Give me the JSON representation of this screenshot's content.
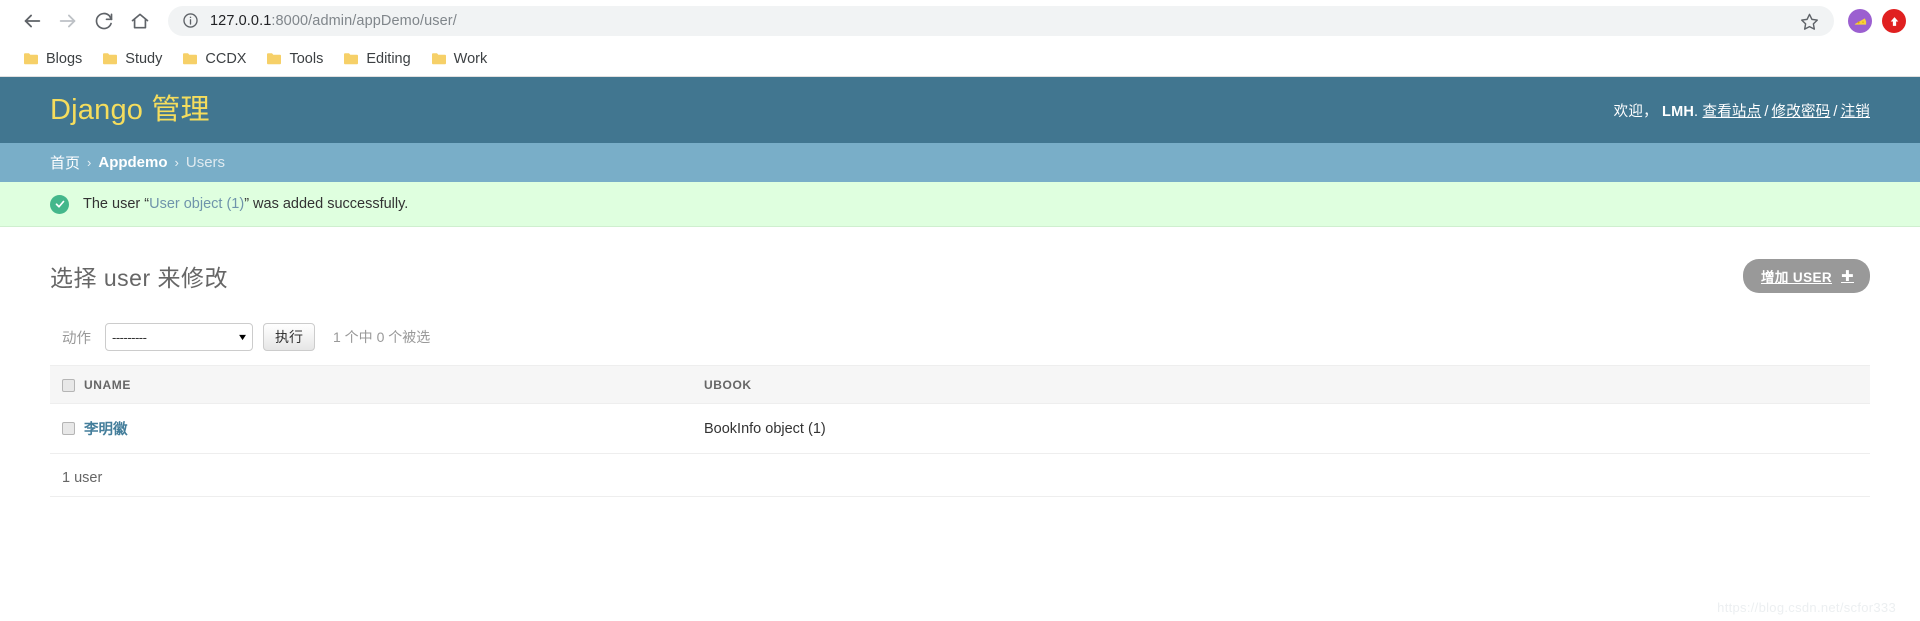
{
  "browser": {
    "nav": {
      "back": "back-arrow",
      "forward": "forward-arrow",
      "reload": "reload",
      "home": "home"
    },
    "url": {
      "host": "127.0.0.1",
      "rest": ":8000/admin/appDemo/user/",
      "full": "127.0.0.1:8000/admin/appDemo/user/"
    },
    "bookmarks": [
      {
        "label": "Blogs"
      },
      {
        "label": "Study"
      },
      {
        "label": "CCDX"
      },
      {
        "label": "Tools"
      },
      {
        "label": "Editing"
      },
      {
        "label": "Work"
      }
    ],
    "extensions": [
      {
        "name": "cheese-extension-icon",
        "color": "#9b5fd0"
      },
      {
        "name": "red-arrow-extension-icon",
        "color": "#e02020"
      }
    ]
  },
  "admin": {
    "brand": "Django 管理",
    "user_tools": {
      "welcome": "欢迎，",
      "username": "LMH",
      "dot": ".",
      "view_site": "查看站点",
      "change_password": "修改密码",
      "logout": "注销",
      "separator": "/"
    },
    "breadcrumbs": {
      "home": "首页",
      "app": "Appdemo",
      "model": "Users",
      "separator": "›"
    },
    "message": {
      "prefix": "The user “",
      "link": "User object (1)",
      "suffix": "” was added successfully.",
      "icon": "success-check-icon"
    },
    "page_title": "选择 user 来修改",
    "add_button": {
      "label": "增加 USER",
      "icon": "plus-icon"
    },
    "actions": {
      "label": "动作",
      "select_value": "---------",
      "go_label": "执行",
      "counter": "1 个中 0 个被选"
    },
    "table": {
      "columns": [
        "UNAME",
        "UBOOK"
      ],
      "rows": [
        {
          "uname": "李明徽",
          "ubook": "BookInfo object (1)"
        }
      ]
    },
    "paginator": "1 user",
    "watermark": "https://blog.csdn.net/scfor333",
    "colors": {
      "header": "#417690",
      "breadcrumb": "#79aec8",
      "brand_text": "#f5dd5d",
      "message_bg": "#dfffdf",
      "link": "#447e9b",
      "add_button": "#999999"
    }
  }
}
